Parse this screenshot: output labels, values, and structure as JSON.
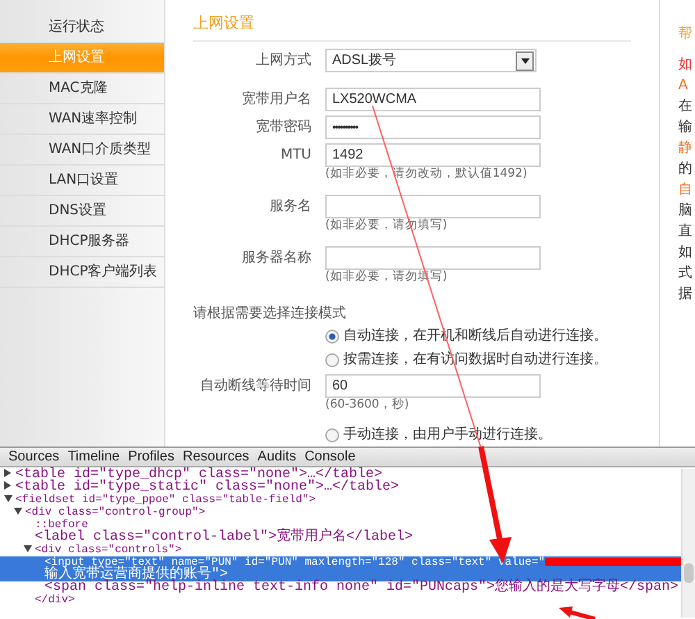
{
  "sidebar": {
    "items": [
      {
        "label": "运行状态",
        "selected": false
      },
      {
        "label": "上网设置",
        "selected": true
      },
      {
        "label": "MAC克隆",
        "selected": false
      },
      {
        "label": "WAN速率控制",
        "selected": false
      },
      {
        "label": "WAN口介质类型",
        "selected": false
      },
      {
        "label": "LAN口设置",
        "selected": false
      },
      {
        "label": "DNS设置",
        "selected": false
      },
      {
        "label": "DHCP服务器",
        "selected": false
      },
      {
        "label": "DHCP客户端列表",
        "selected": false
      }
    ]
  },
  "form": {
    "title": "上网设置",
    "rows": [
      {
        "kind": "select",
        "label": "上网方式",
        "value": "ADSL拨号"
      },
      {
        "kind": "text",
        "label": "宽带用户名",
        "value": "LX520WCMA"
      },
      {
        "kind": "password",
        "label": "宽带密码",
        "value": "••••••••••"
      },
      {
        "kind": "text",
        "label": "MTU",
        "value": "1492",
        "hint": "(如非必要，请勿改动，默认值1492)"
      },
      {
        "kind": "text",
        "label": "服务名",
        "hint": "(如非必要，请勿填写)"
      },
      {
        "kind": "text",
        "label": "服务器名称",
        "hint": "(如非必要，请勿填写)"
      },
      {
        "kind": "heading",
        "label": "请根据需要选择连接模式"
      },
      {
        "kind": "radio",
        "label": "自动连接，在开机和断线后自动进行连接。",
        "selected": true
      },
      {
        "kind": "radio",
        "label": "按需连接，在有访问数据时自动进行连接。",
        "selected": false
      },
      {
        "kind": "text",
        "label": "自动断线等待时间",
        "value": "60",
        "hint": "(60-3600，秒)"
      },
      {
        "kind": "radio",
        "label": "手动连接，由用户手动进行连接。",
        "selected": false
      }
    ]
  },
  "help": {
    "lines": [
      {
        "text": "帮",
        "kind": "title"
      },
      {
        "text": "如",
        "kind": "heading"
      },
      {
        "text": "A",
        "kind": "sub"
      },
      {
        "text": "在",
        "kind": "body"
      },
      {
        "text": "输",
        "kind": "body"
      },
      {
        "text": "静",
        "kind": "sub"
      },
      {
        "text": "的",
        "kind": "body"
      },
      {
        "text": "自",
        "kind": "sub"
      },
      {
        "text": "脑",
        "kind": "body"
      },
      {
        "text": "直",
        "kind": "body"
      },
      {
        "text": "如",
        "kind": "body"
      },
      {
        "text": "式",
        "kind": "body"
      },
      {
        "text": "据",
        "kind": "body"
      }
    ]
  },
  "devtools": {
    "tabs": [
      {
        "label": "Sources",
        "selected": false
      },
      {
        "label": "Timeline",
        "selected": false
      },
      {
        "label": "Profiles",
        "selected": false
      },
      {
        "label": "Resources",
        "selected": false
      },
      {
        "label": "Audits",
        "selected": false
      },
      {
        "label": "Console",
        "selected": false
      }
    ],
    "nodes": [
      {
        "text": "<table id=\"type_dhcp\" class=\"none\">…</table>",
        "expanded": false,
        "selected": false
      },
      {
        "text": "<table id=\"type_static\" class=\"none\">…</table>",
        "expanded": false,
        "selected": false
      },
      {
        "text": "<fieldset id=\"type_ppoe\" class=\"table-field\">",
        "expanded": true,
        "selected": false,
        "children": [
          {
            "text": "<div class=\"control-group\">",
            "expanded": true,
            "selected": false,
            "children": [
              {
                "text": "::before",
                "selected": false
              },
              {
                "text": "<label class=\"control-label\">宽带用户名</label>",
                "selected": false
              },
              {
                "text": "<div class=\"controls\">",
                "expanded": true,
                "selected": false,
                "children": [
                  {
                    "text": "<input type=\"text\" name=\"PUN\" id=\"PUN\" maxlength=\"128\" class=\"text\" value=\"",
                    "continuation": "输入宽带运营商提供的账号\">",
                    "selected": true
                  },
                  {
                    "text": "<span class=\"help-inline text-info none\" id=\"PUNcaps\">您输入的是大写字母</span>",
                    "selected": false
                  }
                ]
              },
              {
                "text": "</div>",
                "selected": false
              }
            ]
          }
        ]
      }
    ]
  }
}
